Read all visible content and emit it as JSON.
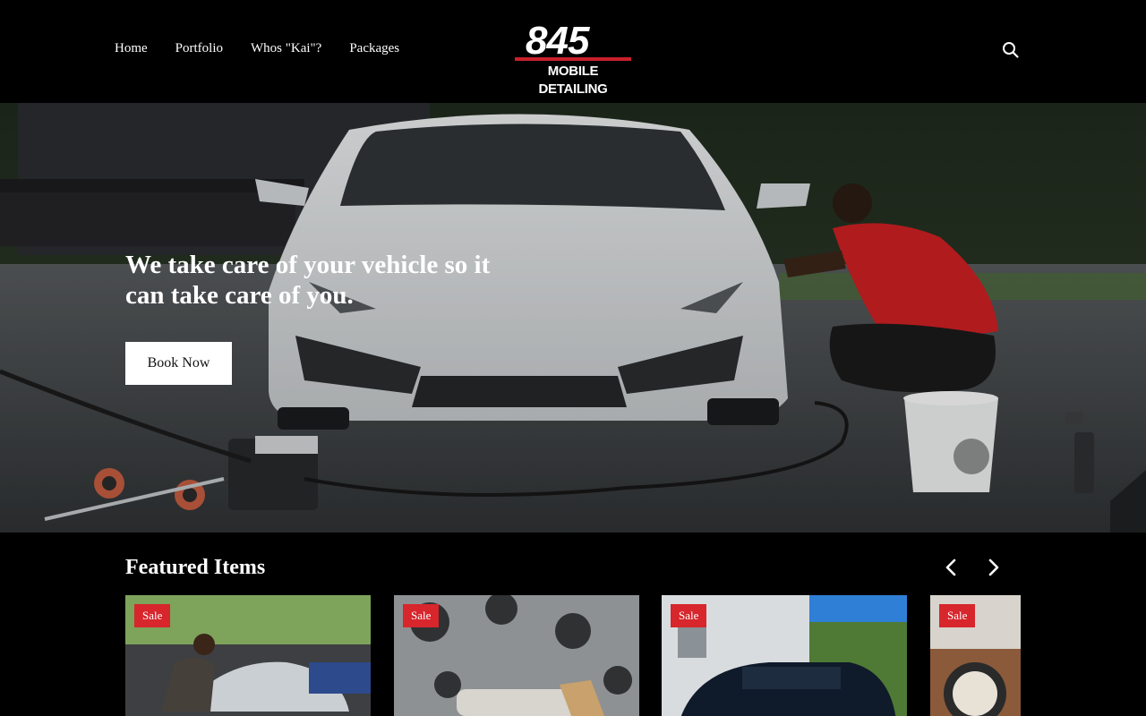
{
  "header": {
    "nav": [
      "Home",
      "Portfolio",
      "Whos \"Kai\"?",
      "Packages"
    ],
    "logo_number": "845",
    "logo_text": "MOBILE DETAILING"
  },
  "hero": {
    "title": "We take care of your vehicle so it can take care of you.",
    "button_label": "Book Now"
  },
  "featured": {
    "title": "Featured Items",
    "cards": [
      {
        "badge": "Sale"
      },
      {
        "badge": "Sale"
      },
      {
        "badge": "Sale"
      },
      {
        "badge": "Sale"
      }
    ]
  },
  "colors": {
    "background": "#000000",
    "sale_badge": "#d7262c",
    "logo_accent": "#c8202a"
  },
  "icons": {
    "search": "search-icon",
    "prev": "chevron-left-icon",
    "next": "chevron-right-icon"
  }
}
